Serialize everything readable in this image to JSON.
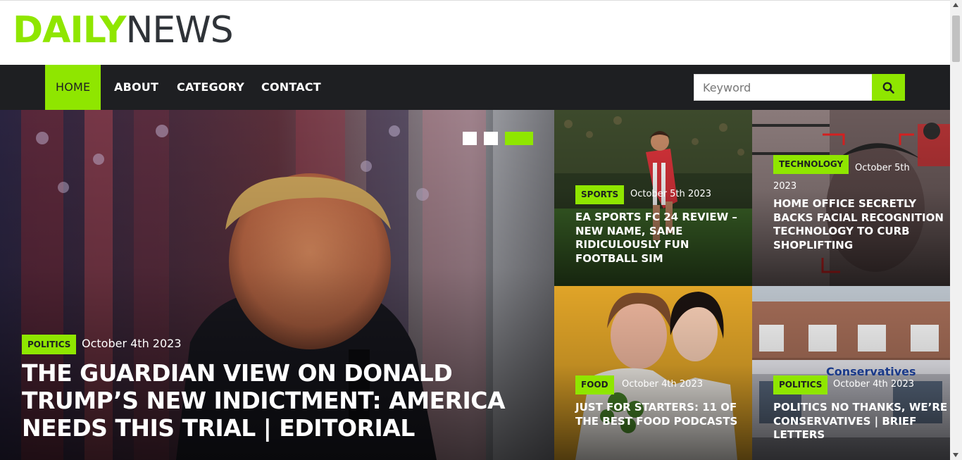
{
  "logo": {
    "part1": "DAILY",
    "part2": "NEWS"
  },
  "nav": {
    "items": [
      {
        "label": "HOME",
        "active": true
      },
      {
        "label": "ABOUT",
        "active": false
      },
      {
        "label": "CATEGORY",
        "active": false
      },
      {
        "label": "CONTACT",
        "active": false
      }
    ],
    "search_placeholder": "Keyword",
    "search_icon": "search-icon"
  },
  "colors": {
    "accent": "#8fe600",
    "dark": "#1e1f22"
  },
  "hero": {
    "category": "POLITICS",
    "date": "October 4th 2023",
    "title": "THE GUARDIAN VIEW ON DONALD TRUMP’S NEW INDICTMENT: AMERICA NEEDS THIS TRIAL | EDITORIAL",
    "slides": 3,
    "active_slide": 3
  },
  "cards": [
    {
      "category": "SPORTS",
      "date": "October 5th 2023",
      "title": "EA SPORTS FC 24 REVIEW – NEW NAME, SAME RIDICULOUSLY FUN FOOTBALL SIM"
    },
    {
      "category": "TECHNOLOGY",
      "date": "October 5th 2023",
      "title": "HOME OFFICE SECRETLY BACKS FACIAL RECOGNITION TECHNOLOGY TO CURB SHOPLIFTING"
    },
    {
      "category": "FOOD",
      "date": "October 4th 2023",
      "title": "JUST FOR STARTERS: 11 OF THE BEST FOOD PODCASTS"
    },
    {
      "category": "POLITICS",
      "date": "October 4th 2023",
      "title": "POLITICS NO THANKS, WE’RE CONSERVATIVES | BRIEF LETTERS",
      "image_text": "Conservatives"
    }
  ]
}
